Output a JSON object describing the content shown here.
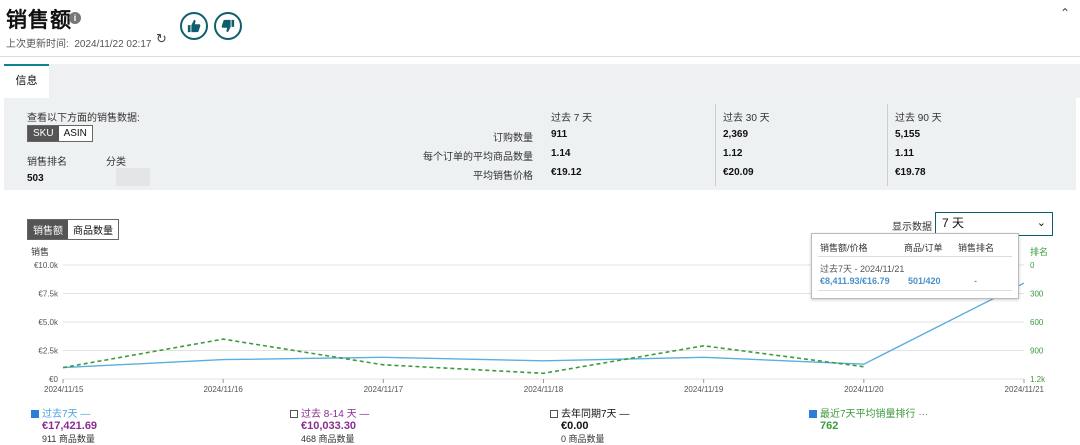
{
  "header": {
    "title": "销售额",
    "last_updated_label": "上次更新时间:",
    "last_updated_value": "2024/11/22 02:17"
  },
  "tabs": [
    {
      "label": "信息",
      "active": true
    }
  ],
  "panel": {
    "view_label": "查看以下方面的销售数据:",
    "toggle": [
      "SKU",
      "ASIN"
    ],
    "rank_label": "销售排名",
    "rank_value": "503",
    "category_label": "分类",
    "metrics": [
      "订购数量",
      "每个订单的平均商品数量",
      "平均销售价格"
    ],
    "periods": [
      {
        "header": "过去 7 天",
        "values": [
          "911",
          "1.14",
          "€19.12"
        ]
      },
      {
        "header": "过去 30 天",
        "values": [
          "2,369",
          "1.12",
          "€20.09"
        ]
      },
      {
        "header": "过去 90 天",
        "values": [
          "5,155",
          "1.11",
          "€19.78"
        ]
      }
    ]
  },
  "chart_controls": {
    "toggle": [
      "销售额",
      "商品数量"
    ],
    "display_label": "显示数据",
    "display_value": "7 天"
  },
  "tooltip": {
    "headers": [
      "销售额/价格",
      "商品/订单",
      "销售排名"
    ],
    "period": "过去7天 - 2024/11/21",
    "values": [
      "€8,411.93/€16.79",
      "501/420",
      "-"
    ]
  },
  "legend": [
    {
      "label": "过去7天",
      "value": "€17,421.69",
      "sub": "911 商品数量",
      "checked": true,
      "color": "#4aa3df"
    },
    {
      "label": "过去 8-14 天",
      "value": "€10,033.30",
      "sub": "468 商品数量",
      "checked": false,
      "color": "#8a2d8f"
    },
    {
      "label": "去年同期7天",
      "value": "€0.00",
      "sub": "0 商品数量",
      "checked": false,
      "color": "#111111"
    },
    {
      "label": "最近7天平均销量排行",
      "value": "762",
      "sub": "",
      "checked": true,
      "color": "#3d9b3d"
    }
  ],
  "colors": {
    "accent": "#0d5f6e",
    "sales_line": "#5aaee0",
    "rank_line": "#3d9b3d"
  },
  "chart_data": {
    "type": "line",
    "ylabel": "销售",
    "y2label": "排名",
    "x": [
      "2024/11/15",
      "2024/11/16",
      "2024/11/17",
      "2024/11/18",
      "2024/11/19",
      "2024/11/20",
      "2024/11/21"
    ],
    "y_ticks": [
      "€0",
      "€2.5k",
      "€5.0k",
      "€7.5k",
      "€10.0k"
    ],
    "y2_ticks": [
      "0",
      "300",
      "600",
      "900",
      "1.2k"
    ],
    "ylim": [
      0,
      10000
    ],
    "y2lim": [
      0,
      1200
    ],
    "series": [
      {
        "name": "过去7天",
        "axis": "left",
        "style": "solid",
        "values": [
          1000,
          1700,
          1900,
          1600,
          1900,
          1300,
          8411.93
        ]
      },
      {
        "name": "最近7天平均销量排行",
        "axis": "right",
        "style": "dashed",
        "values": [
          1080,
          780,
          1050,
          1140,
          850,
          1070,
          null
        ]
      }
    ]
  }
}
